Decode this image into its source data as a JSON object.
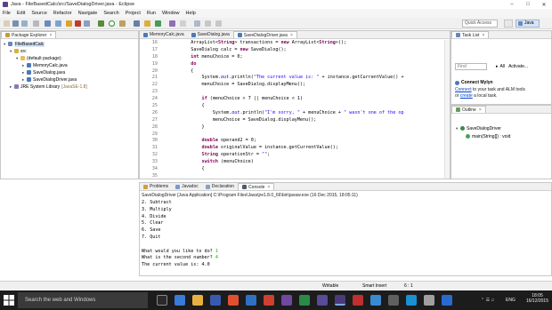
{
  "window": {
    "title": "Java - FileBasedCalc/src/SaveDialogDriver.java - Eclipse"
  },
  "menu": [
    "File",
    "Edit",
    "Source",
    "Refactor",
    "Navigate",
    "Search",
    "Project",
    "Run",
    "Window",
    "Help"
  ],
  "toolbar": {
    "quick_access_placeholder": "Quick Access",
    "perspective": "Java"
  },
  "package_explorer": {
    "tab": "Package Explorer",
    "project": "FileBasedCalc",
    "src": "src",
    "default_package": "(default package)",
    "files": [
      "MemoryCalc.java",
      "SaveDialog.java",
      "SaveDialogDriver.java"
    ],
    "jre": "JRE System Library",
    "jre_version": "[JavaSE-1.8]"
  },
  "editor": {
    "tabs": [
      "MemoryCalc.java",
      "SaveDialog.java",
      "SaveDialogDriver.java"
    ],
    "line_numbers": [
      "16",
      "17",
      "18",
      "19",
      "20",
      "21",
      "22",
      "23",
      "24",
      "25",
      "26",
      "27",
      "28",
      "29",
      "30",
      "31",
      "32",
      "33",
      "34",
      "35"
    ],
    "lines": [
      "    ArrayList<String> transactions = new ArrayList<String>();",
      "    SaveDialog calc = new SaveDialog();",
      "    int menuChoice = 0;",
      "    do",
      "    {",
      "        System.out.println(\"The current value is: \" + instance.getCurrentValue() +",
      "        menuChoice = SaveDialog.displayMenu();",
      "",
      "        if (menuChoice > 7 || menuChoice < 1)",
      "        {",
      "            System.out.println(\"I'm sorry, \" + menuChoice + \" wasn't one of the op",
      "            menuChoice = SaveDialog.displayMenu();",
      "        }",
      "",
      "        double operand2 = 0;",
      "        double originalValue = instance.getCurrentValue();",
      "        String operationStr = \"\";",
      "        switch (menuChoice)",
      "        {",
      ""
    ]
  },
  "task_list": {
    "tab": "Task List",
    "find_placeholder": "Find",
    "all_label": "All",
    "activate_label": "Activate...",
    "mylyn_title": "Connect Mylyn",
    "mylyn_link1": "Connect",
    "mylyn_text1": " to your task and ALM tools",
    "mylyn_text2": "or ",
    "mylyn_link2": "create",
    "mylyn_text3": " a local task."
  },
  "outline": {
    "tab": "Outline",
    "class_name": "SaveDialogDriver",
    "method": "main(String[]) : void"
  },
  "console": {
    "tabs": [
      "Problems",
      "Javadoc",
      "Declaration",
      "Console"
    ],
    "active_tab": "Console",
    "description": "SaveDialogDriver [Java Application] C:\\Program Files\\Java\\jre1.8.0_66\\bin\\javaw.exe (16 Dec 2015, 18:05:11)",
    "output": [
      {
        "text": "2. Subtract",
        "input": ""
      },
      {
        "text": "3. Multiply",
        "input": ""
      },
      {
        "text": "4. Divide",
        "input": ""
      },
      {
        "text": "5. Clear",
        "input": ""
      },
      {
        "text": "6. Save",
        "input": ""
      },
      {
        "text": "7. Quit",
        "input": ""
      },
      {
        "text": "",
        "input": ""
      },
      {
        "text": "What would you like to do? ",
        "input": "1"
      },
      {
        "text": "What is the second number? ",
        "input": "4"
      },
      {
        "text": "The current value is: 4.0",
        "input": ""
      }
    ]
  },
  "status": {
    "writable": "Writable",
    "insert": "Smart Insert",
    "position": "6 : 1"
  },
  "taskbar": {
    "search_placeholder": "Search the web and Windows",
    "language": "ENG",
    "time": "18:05",
    "date": "16/12/2015"
  },
  "colors": {
    "keyword": "#7f0055",
    "string": "#2a00ff",
    "console_input": "#00c000",
    "taskbar": "#1c1c1c"
  }
}
